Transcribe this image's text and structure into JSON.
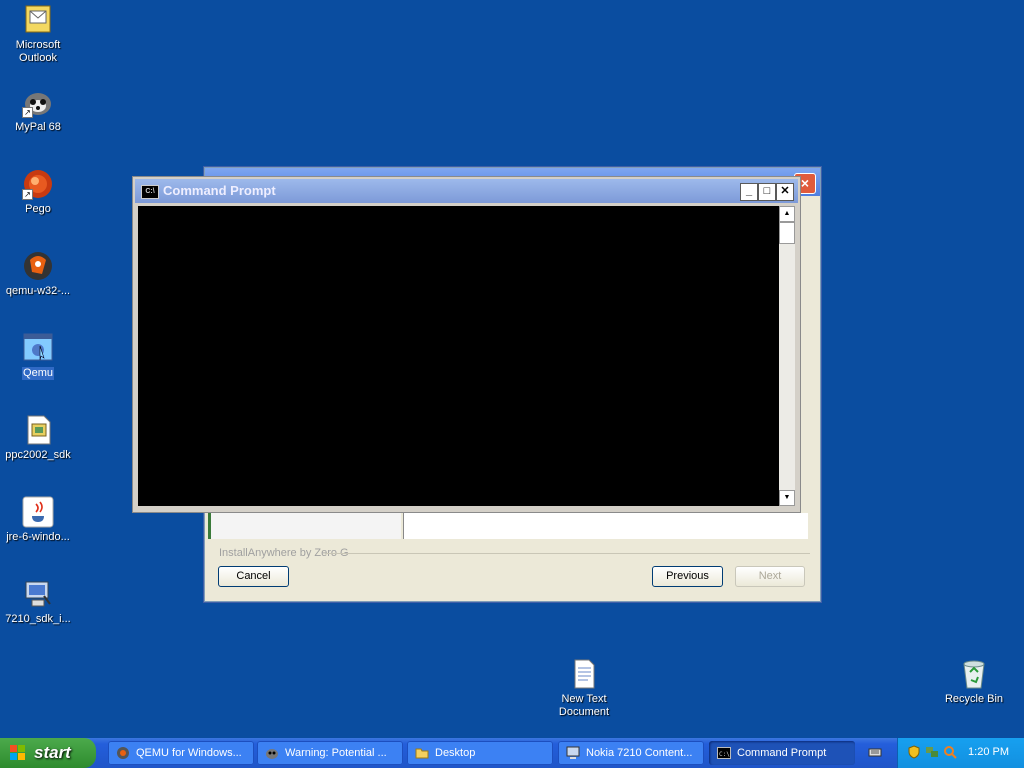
{
  "desktop": {
    "icons": [
      {
        "label": "Microsoft Outlook",
        "icon": "outlook-icon"
      },
      {
        "label": "MyPal 68",
        "icon": "mypal-icon"
      },
      {
        "label": "Pego",
        "icon": "pego-icon"
      },
      {
        "label": "qemu-w32-...",
        "icon": "qemu-installer-icon"
      },
      {
        "label": "Qemu",
        "icon": "qemu-icon"
      },
      {
        "label": "ppc2002_sdk",
        "icon": "setup-icon"
      },
      {
        "label": "jre-6-windo...",
        "icon": "java-icon"
      },
      {
        "label": "7210_sdk_i...",
        "icon": "installer-icon"
      },
      {
        "label": "New Text Document",
        "icon": "text-document-icon"
      },
      {
        "label": "Recycle Bin",
        "icon": "recycle-bin-icon"
      }
    ]
  },
  "installer": {
    "credit": "InstallAnywhere by Zero G",
    "cancel": "Cancel",
    "previous": "Previous",
    "next": "Next"
  },
  "cmd": {
    "title": "Command Prompt",
    "icon_text": "C:\\"
  },
  "taskbar": {
    "start": "start",
    "items": [
      {
        "label": "QEMU for Windows...",
        "icon": "qemu-task-icon"
      },
      {
        "label": "Warning: Potential ...",
        "icon": "mypal-task-icon"
      },
      {
        "label": "Desktop",
        "icon": "folder-icon"
      },
      {
        "label": "Nokia 7210 Content...",
        "icon": "installer-task-icon"
      },
      {
        "label": "Command Prompt",
        "icon": "cmd-task-icon"
      }
    ],
    "clock": "1:20 PM"
  },
  "colors": {
    "desktop": "#0a4da0",
    "taskbar": "#245edb",
    "start": "#2e8b2e",
    "tray": "#1290e0"
  }
}
